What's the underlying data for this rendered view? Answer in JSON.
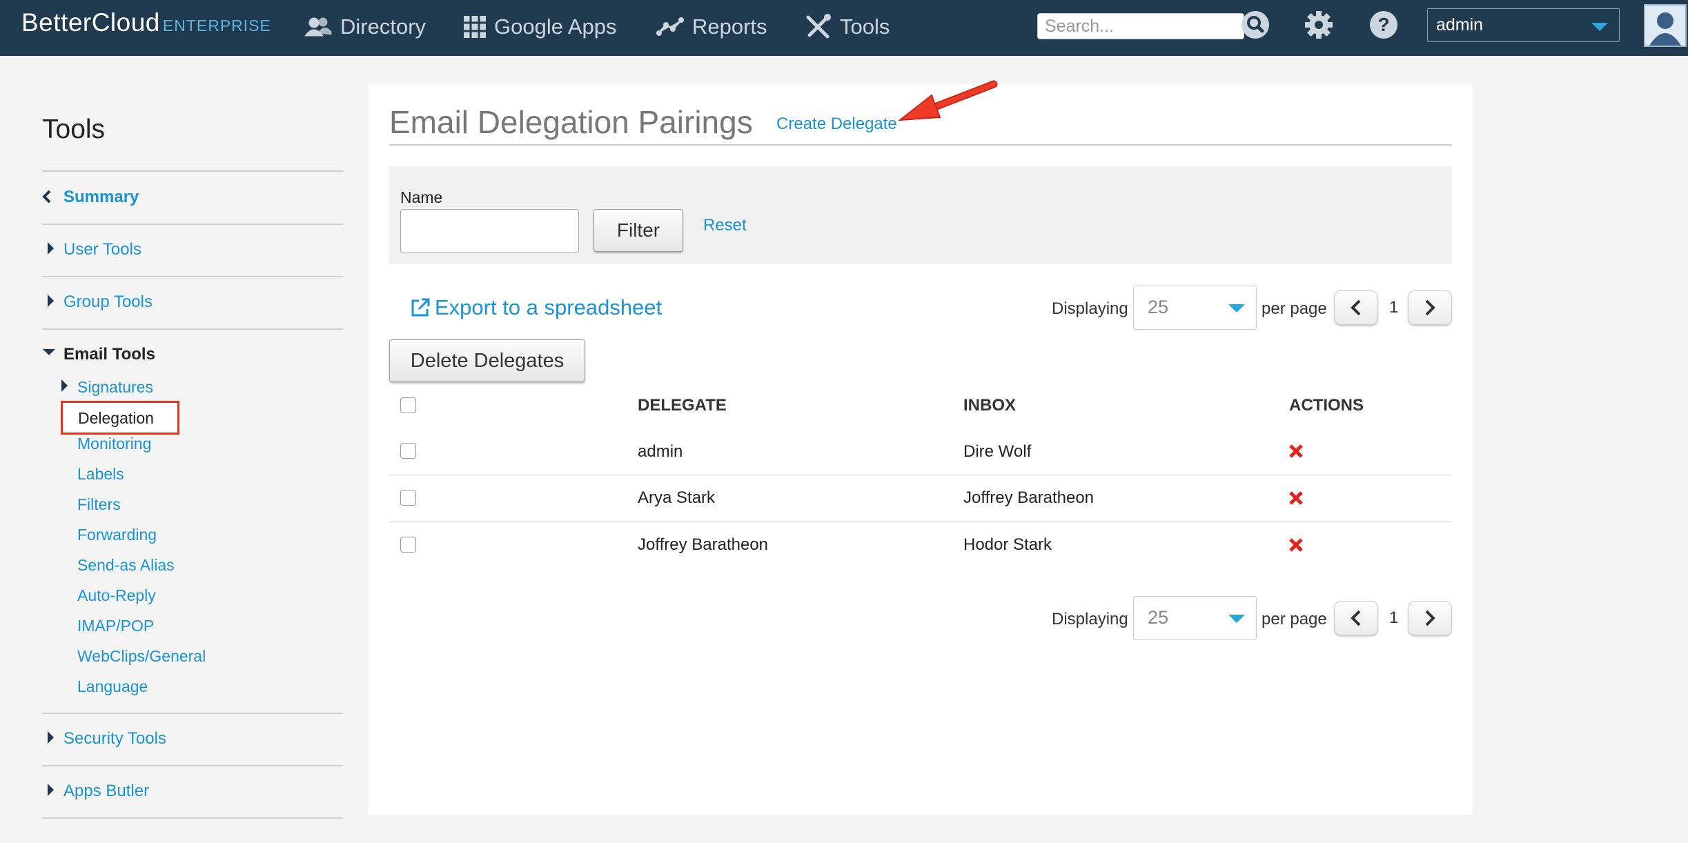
{
  "nav": {
    "logo_main": "BetterCloud",
    "logo_sub": "ENTERPRISE",
    "items": [
      {
        "label": "Directory",
        "icon": "users-icon"
      },
      {
        "label": "Google Apps",
        "icon": "grid-icon"
      },
      {
        "label": "Reports",
        "icon": "chart-icon"
      },
      {
        "label": "Tools",
        "icon": "tools-icon"
      }
    ],
    "search_placeholder": "Search...",
    "user": "admin"
  },
  "sidebar": {
    "title": "Tools",
    "sections": [
      {
        "label": "Summary"
      },
      {
        "label": "User Tools"
      },
      {
        "label": "Group Tools"
      },
      {
        "label": "Email Tools"
      },
      {
        "label": "Security Tools"
      },
      {
        "label": "Apps Butler"
      }
    ],
    "email_sub": [
      "Signatures",
      "Delegation",
      "Monitoring",
      "Labels",
      "Filters",
      "Forwarding",
      "Send-as Alias",
      "Auto-Reply",
      "IMAP/POP",
      "WebClips/General",
      "Language"
    ]
  },
  "main": {
    "title": "Email Delegation Pairings",
    "create_link": "Create Delegate",
    "filter": {
      "name_label": "Name",
      "filter_button": "Filter",
      "reset_link": "Reset"
    },
    "export_link": "Export to a spreadsheet",
    "delete_button": "Delete Delegates",
    "pagination": {
      "displaying": "Displaying",
      "per_page_value": "25",
      "per_page": "per page",
      "page": "1"
    },
    "table": {
      "headers": [
        "DELEGATE",
        "INBOX",
        "ACTIONS"
      ],
      "rows": [
        {
          "delegate": "admin",
          "inbox": "Dire Wolf"
        },
        {
          "delegate": "Arya Stark",
          "inbox": "Joffrey Baratheon"
        },
        {
          "delegate": "Joffrey Baratheon",
          "inbox": "Hodor Stark"
        }
      ]
    }
  },
  "colors": {
    "nav_bg": "#203a4f",
    "link": "#1a93d2",
    "delete_red": "#e8201c",
    "highlight": "#e8321c"
  }
}
